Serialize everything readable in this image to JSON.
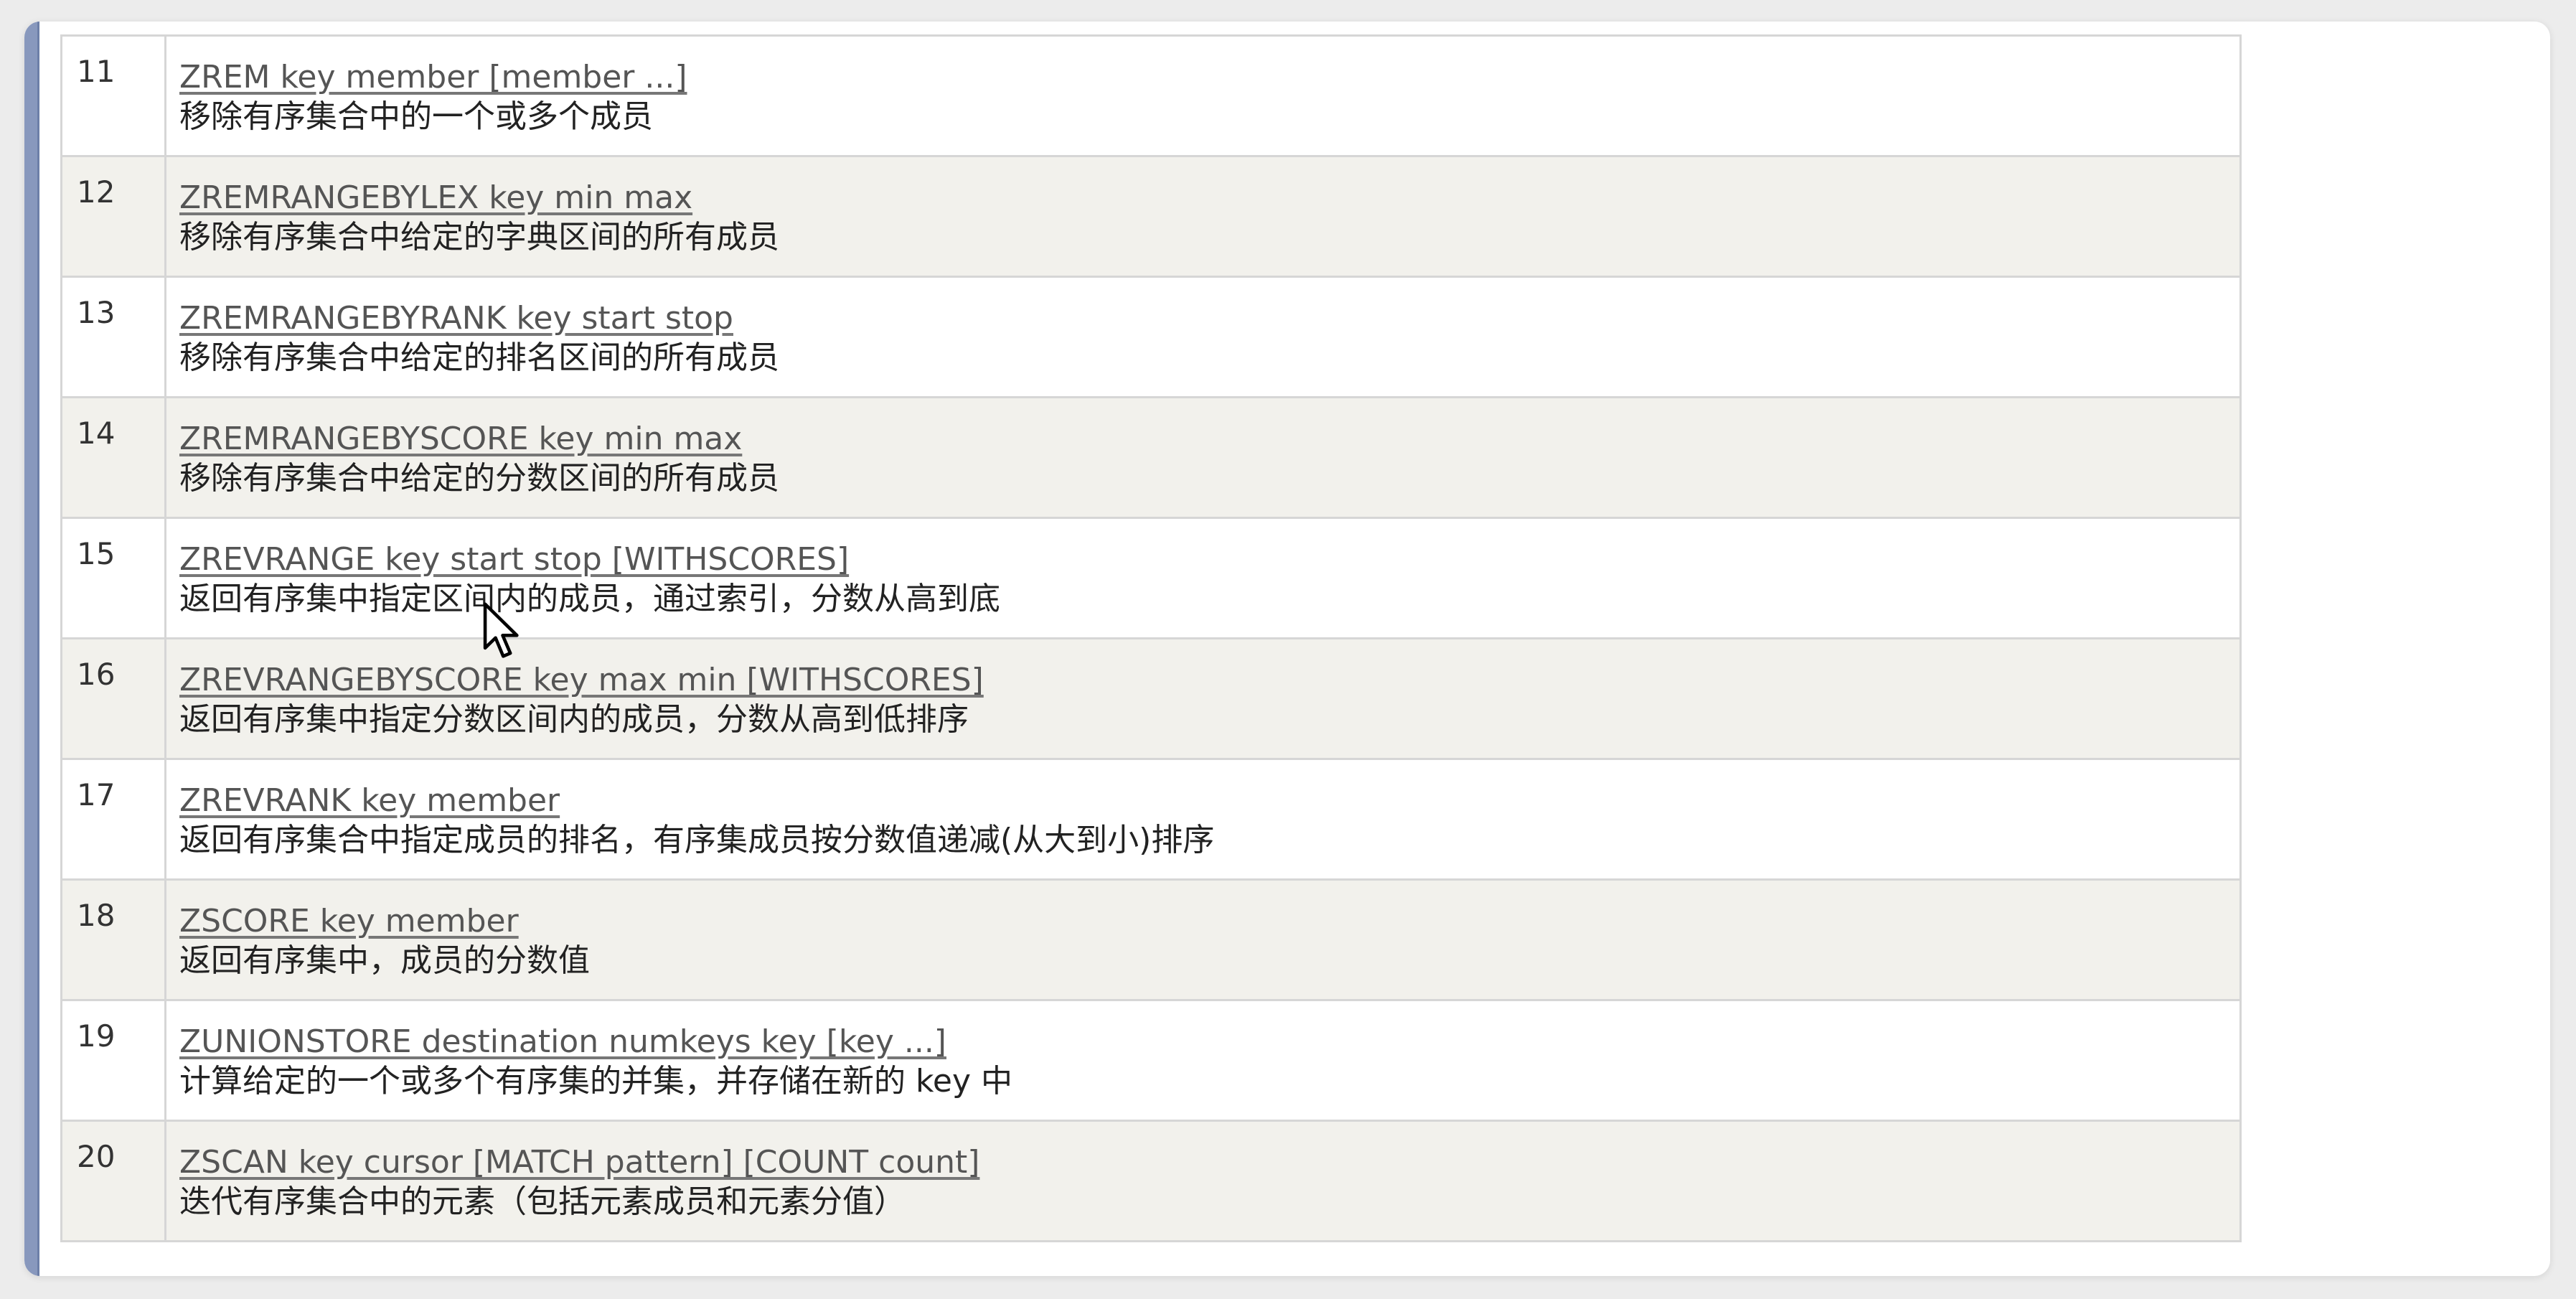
{
  "commands": [
    {
      "num": "11",
      "syntax": "ZREM key member [member ...]",
      "desc": "移除有序集合中的一个或多个成员"
    },
    {
      "num": "12",
      "syntax": "ZREMRANGEBYLEX key min max",
      "desc": "移除有序集合中给定的字典区间的所有成员"
    },
    {
      "num": "13",
      "syntax": "ZREMRANGEBYRANK key start stop",
      "desc": "移除有序集合中给定的排名区间的所有成员"
    },
    {
      "num": "14",
      "syntax": "ZREMRANGEBYSCORE key min max",
      "desc": "移除有序集合中给定的分数区间的所有成员"
    },
    {
      "num": "15",
      "syntax": "ZREVRANGE key start stop [WITHSCORES]",
      "desc": "返回有序集中指定区间内的成员，通过索引，分数从高到底"
    },
    {
      "num": "16",
      "syntax": "ZREVRANGEBYSCORE key max min [WITHSCORES]",
      "desc": "返回有序集中指定分数区间内的成员，分数从高到低排序"
    },
    {
      "num": "17",
      "syntax": "ZREVRANK key member",
      "desc": "返回有序集合中指定成员的排名，有序集成员按分数值递减(从大到小)排序"
    },
    {
      "num": "18",
      "syntax": "ZSCORE key member",
      "desc": "返回有序集中，成员的分数值"
    },
    {
      "num": "19",
      "syntax": "ZUNIONSTORE destination numkeys key [key ...]",
      "desc": "计算给定的一个或多个有序集的并集，并存储在新的 key 中"
    },
    {
      "num": "20",
      "syntax": "ZSCAN key cursor [MATCH pattern] [COUNT count]",
      "desc": "迭代有序集合中的元素（包括元素成员和元素分值）"
    }
  ],
  "icons": {
    "cursor": "mouse-pointer-icon"
  }
}
